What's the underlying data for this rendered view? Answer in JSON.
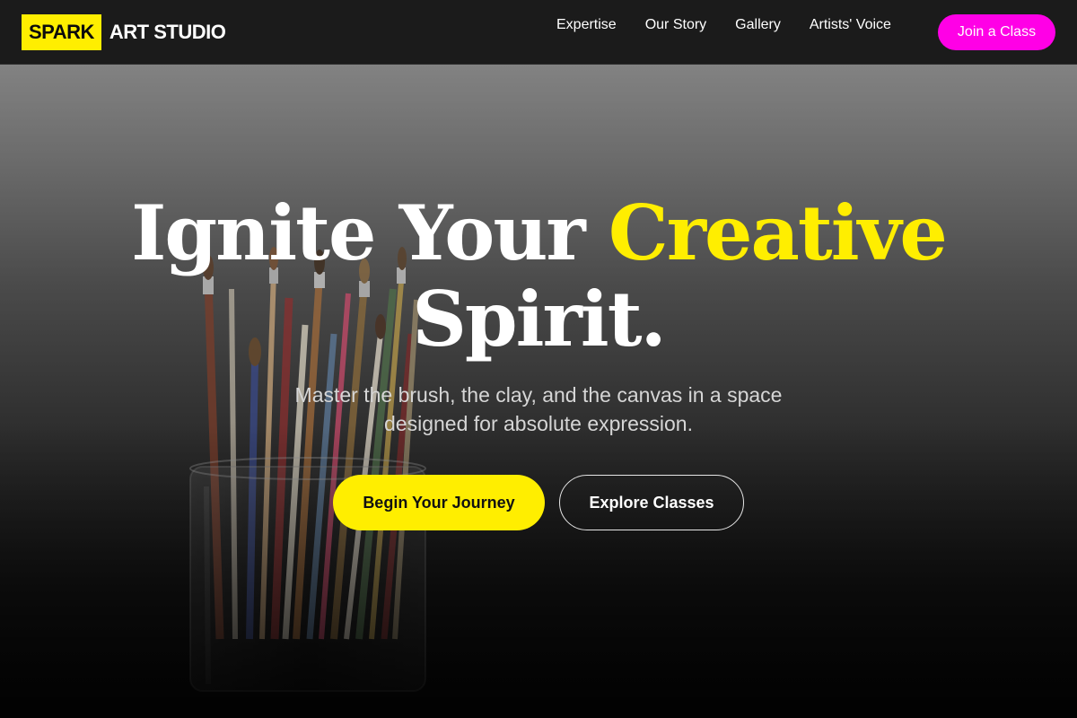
{
  "header": {
    "logo_mark": "SPARK",
    "logo_text": "ART STUDIO",
    "nav": [
      "Expertise",
      "Our Story",
      "Gallery",
      "Artists' Voice"
    ],
    "cta_label": "Join a Class"
  },
  "hero": {
    "headline_part1": "Ignite Your ",
    "headline_accent": "Creative",
    "headline_part2": "Spirit.",
    "subtitle": "Master the brush, the clay, and the canvas in a space designed for absolute expression.",
    "primary_button": "Begin Your Journey",
    "secondary_button": "Explore Classes",
    "background_image": "paintbrushes-in-jar"
  },
  "colors": {
    "accent_yellow": "#ffee00",
    "accent_magenta": "#ff00e6",
    "nav_background": "#1b1b1b"
  }
}
